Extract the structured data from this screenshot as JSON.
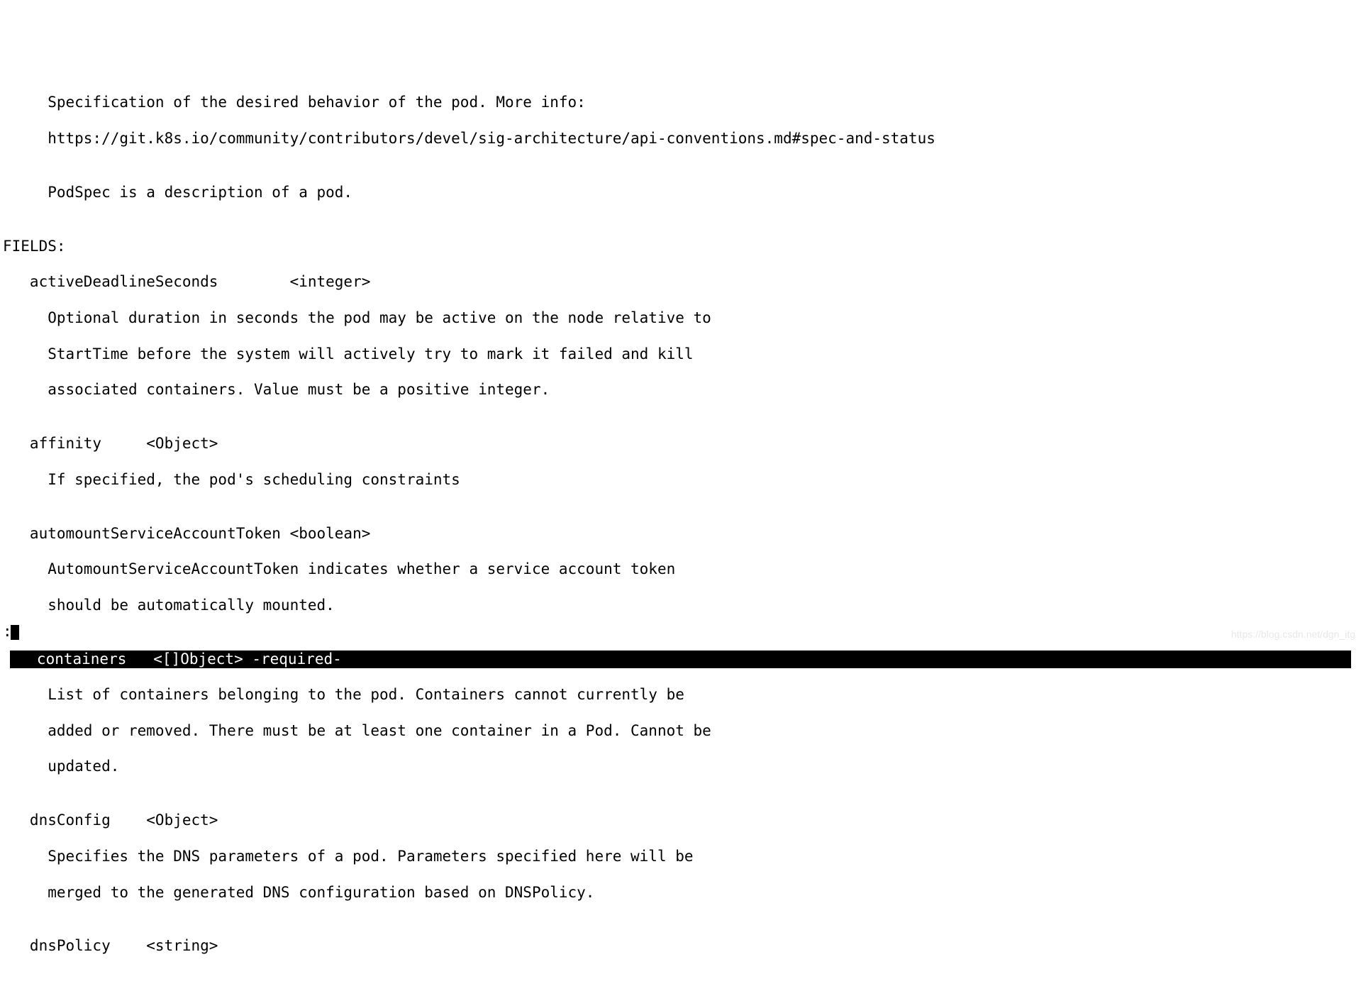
{
  "description": {
    "line1": "     Specification of the desired behavior of the pod. More info:",
    "line2": "     https://git.k8s.io/community/contributors/devel/sig-architecture/api-conventions.md#spec-and-status",
    "line3": "",
    "line4": "     PodSpec is a description of a pod.",
    "line5": ""
  },
  "fieldsHeader": "FIELDS:",
  "fields": {
    "activeDeadlineSeconds": {
      "header": "   activeDeadlineSeconds        <integer>",
      "desc1": "     Optional duration in seconds the pod may be active on the node relative to",
      "desc2": "     StartTime before the system will actively try to mark it failed and kill",
      "desc3": "     associated containers. Value must be a positive integer."
    },
    "affinity": {
      "header": "   affinity     <Object>",
      "desc1": "     If specified, the pod's scheduling constraints"
    },
    "automountServiceAccountToken": {
      "header": "   automountServiceAccountToken <boolean>",
      "desc1": "     AutomountServiceAccountToken indicates whether a service account token",
      "desc2": "     should be automatically mounted."
    },
    "containers": {
      "header": "   containers   <[]Object> -required-",
      "desc1": "     List of containers belonging to the pod. Containers cannot currently be",
      "desc2": "     added or removed. There must be at least one container in a Pod. Cannot be",
      "desc3": "     updated."
    },
    "dnsConfig": {
      "header": "   dnsConfig    <Object>",
      "desc1": "     Specifies the DNS parameters of a pod. Parameters specified here will be",
      "desc2": "     merged to the generated DNS configuration based on DNSPolicy."
    },
    "dnsPolicy": {
      "header": "   dnsPolicy    <string>"
    }
  },
  "blank": "",
  "prompt": ":",
  "watermark": "https://blog.csdn.net/dgn_itg"
}
